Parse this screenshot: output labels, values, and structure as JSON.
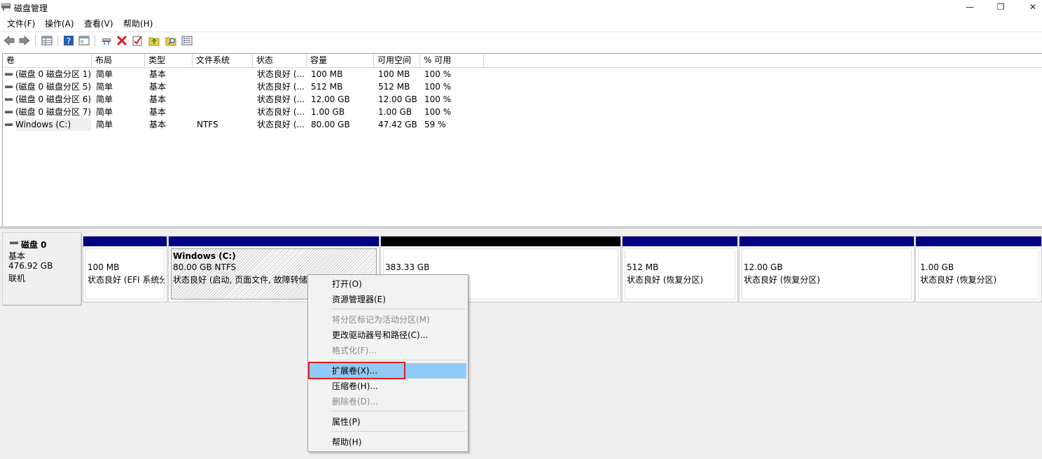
{
  "window": {
    "title": "磁盘管理",
    "min_glyph": "—",
    "max_glyph": "❐",
    "close_glyph": "✕"
  },
  "menu": [
    "文件(F)",
    "操作(A)",
    "查看(V)",
    "帮助(H)"
  ],
  "toolbar": {
    "icons": [
      "back-icon",
      "forward-icon",
      "properties-grid-icon",
      "help-icon",
      "console-tree-icon",
      "connect-disk-icon",
      "delete-icon",
      "check-icon",
      "folder-up-icon",
      "search-folder-icon",
      "list-view-icon"
    ]
  },
  "volume_table": {
    "columns": [
      "卷",
      "布局",
      "类型",
      "文件系统",
      "状态",
      "容量",
      "可用空间",
      "% 可用"
    ],
    "rows": [
      [
        "(磁盘 0 磁盘分区 1)",
        "简单",
        "基本",
        "",
        "状态良好 (...",
        "100 MB",
        "100 MB",
        "100 %"
      ],
      [
        "(磁盘 0 磁盘分区 5)",
        "简单",
        "基本",
        "",
        "状态良好 (...",
        "512 MB",
        "512 MB",
        "100 %"
      ],
      [
        "(磁盘 0 磁盘分区 6)",
        "简单",
        "基本",
        "",
        "状态良好 (...",
        "12.00 GB",
        "12.00 GB",
        "100 %"
      ],
      [
        "(磁盘 0 磁盘分区 7)",
        "简单",
        "基本",
        "",
        "状态良好 (...",
        "1.00 GB",
        "1.00 GB",
        "100 %"
      ],
      [
        "Windows (C:)",
        "简单",
        "基本",
        "NTFS",
        "状态良好 (...",
        "80.00 GB",
        "47.42 GB",
        "59 %"
      ]
    ]
  },
  "disk": {
    "name": "磁盘 0",
    "type": "基本",
    "size": "476.92 GB",
    "status": "联机"
  },
  "partitions": [
    {
      "title": "",
      "size": "100 MB",
      "status": "状态良好 (EFI 系统分"
    },
    {
      "title": "Windows  (C:)",
      "size": "80.00 GB NTFS",
      "status": "状态良好 (启动, 页面文件, 故障转储,"
    },
    {
      "title": "",
      "size": "383.33 GB",
      "status": ""
    },
    {
      "title": "",
      "size": "512 MB",
      "status": "状态良好 (恢复分区)"
    },
    {
      "title": "",
      "size": "12.00 GB",
      "status": "状态良好 (恢复分区)"
    },
    {
      "title": "",
      "size": "1.00 GB",
      "status": "状态良好 (恢复分区)"
    }
  ],
  "context_menu": {
    "items": [
      {
        "label": "打开(O)",
        "enabled": true
      },
      {
        "label": "资源管理器(E)",
        "enabled": true
      },
      {
        "label": "将分区标记为活动分区(M)",
        "enabled": false
      },
      {
        "label": "更改驱动器号和路径(C)...",
        "enabled": true
      },
      {
        "label": "格式化(F)...",
        "enabled": false
      },
      {
        "label": "扩展卷(X)...",
        "enabled": true,
        "highlighted": true
      },
      {
        "label": "压缩卷(H)...",
        "enabled": true
      },
      {
        "label": "删除卷(D)...",
        "enabled": false
      },
      {
        "label": "属性(P)",
        "enabled": true
      },
      {
        "label": "帮助(H)",
        "enabled": true
      }
    ]
  },
  "colors": {
    "partition_bar": "#000080",
    "unallocated_bar": "#000000",
    "highlight": "#91c9f7",
    "annotation_box": "#e0201f"
  }
}
